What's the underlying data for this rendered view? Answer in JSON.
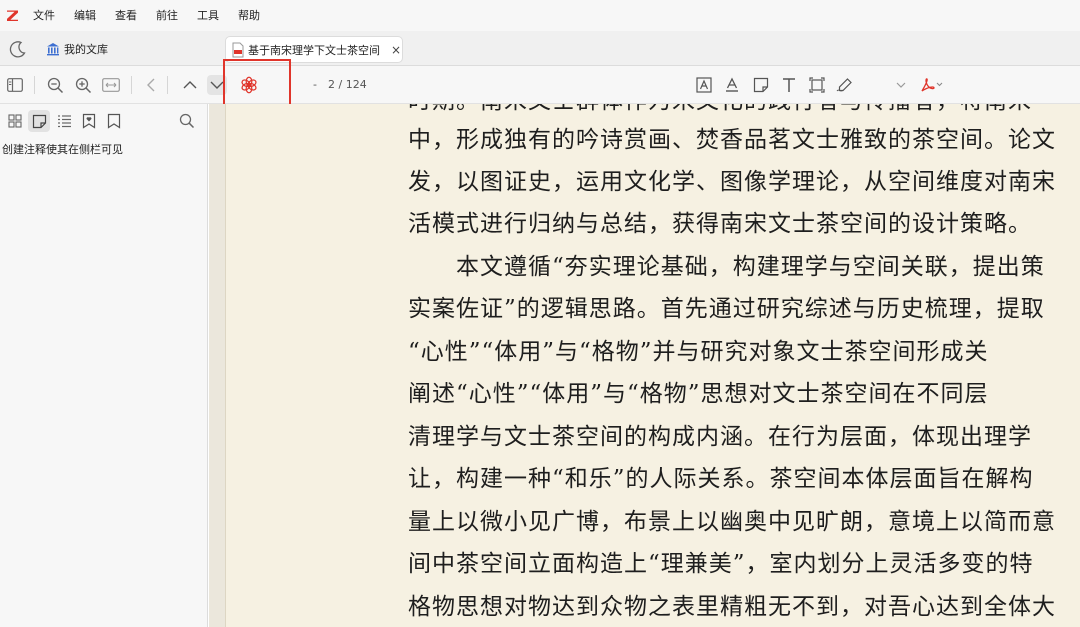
{
  "menu": {
    "logo": "Z",
    "items": [
      "文件",
      "编辑",
      "查看",
      "前往",
      "工具",
      "帮助"
    ]
  },
  "tabs": {
    "library_label": "我的文库",
    "document_title": "基于南宋理学下文士茶空间",
    "close_icon": "×"
  },
  "toolbar": {
    "page_dash": "-",
    "page_indicator": "2 / 124"
  },
  "sidebar": {
    "hint": "创建注释使其在侧栏可见"
  },
  "document": {
    "lines": [
      "时期。南宋文士群体作为宋文化的践行者与传播者，将南宋",
      "中，形成独有的吟诗赏画、焚香品茗文士雅致的茶空间。论文",
      "发，以图证史，运用文化学、图像学理论，从空间维度对南宋",
      "活模式进行归纳与总结，获得南宋文士茶空间的设计策略。",
      "　　本文遵循“夯实理论基础，构建理学与空间关联，提出策",
      "实案佐证”的逻辑思路。首先通过研究综述与历史梳理，提取",
      "“心性”“体用”与“格物”并与研究对象文士茶空间形成关",
      "阐述“心性”“体用”与“格物”思想对文士茶空间在不同层",
      "清理学与文士茶空间的构成内涵。在行为层面，体现出理学",
      "让，构建一种“和乐”的人际关系。茶空间本体层面旨在解构",
      "量上以微小见广博，布景上以幽奥中见旷朗，意境上以简而意",
      "间中茶空间立面构造上“理兼美”，室内划分上灵活多变的特",
      "格物思想对物达到众物之表里精粗无不到，对吾心达到全体大"
    ]
  },
  "colors": {
    "accent_red": "#e0352b",
    "page_bg": "#f6f1e2",
    "reader_bg": "#ebe7dc"
  }
}
